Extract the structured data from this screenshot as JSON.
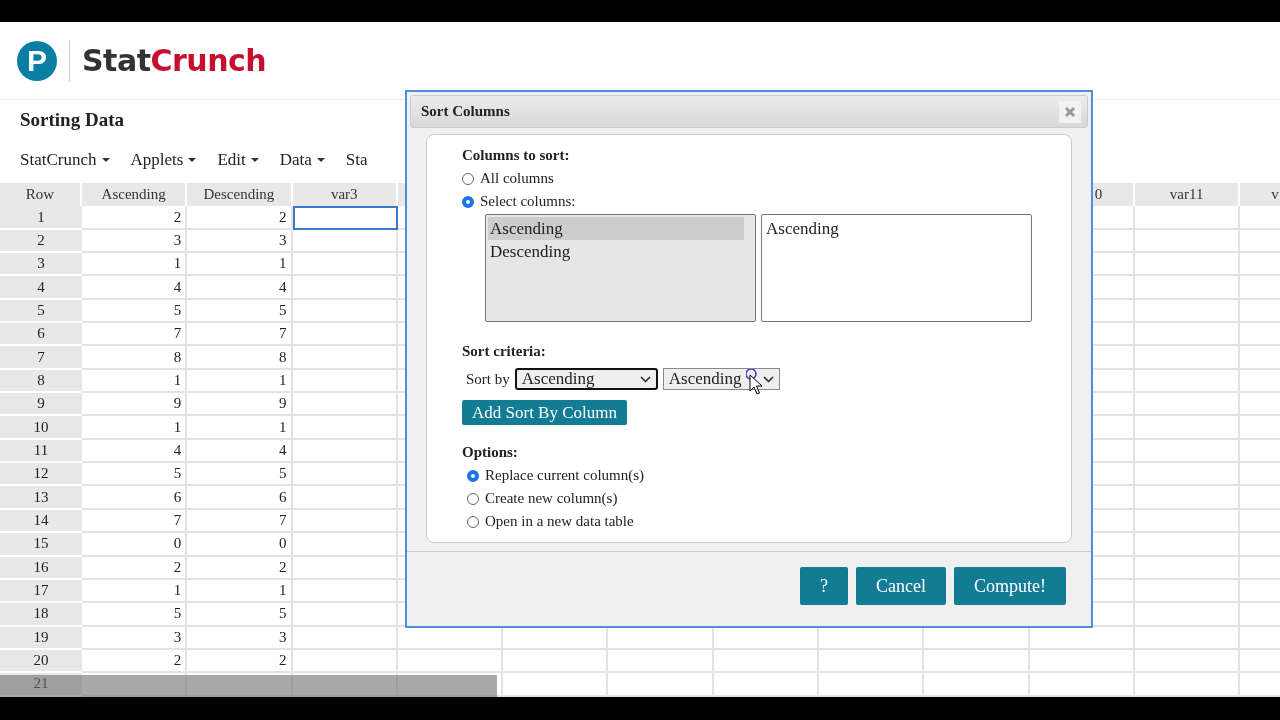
{
  "logo": {
    "mark": "P",
    "brand": [
      {
        "text": "Stat",
        "accent": false
      },
      {
        "text": "Crunch",
        "accent": true
      }
    ]
  },
  "page_title": "Sorting Data",
  "menu": [
    {
      "label": "StatCrunch",
      "caret": true
    },
    {
      "label": "Applets",
      "caret": true
    },
    {
      "label": "Edit",
      "caret": true
    },
    {
      "label": "Data",
      "caret": true
    },
    {
      "label": "Sta",
      "caret": false
    }
  ],
  "grid": {
    "columns": [
      "Row",
      "Ascending",
      "Descending",
      "var3",
      "0",
      "var11",
      "v"
    ],
    "rows": [
      {
        "row": "1",
        "values": [
          "2",
          "2"
        ],
        "current": true
      },
      {
        "row": "2",
        "values": [
          "3",
          "3"
        ],
        "current": false
      },
      {
        "row": "3",
        "values": [
          "1",
          "1"
        ],
        "current": false
      },
      {
        "row": "4",
        "values": [
          "4",
          "4"
        ],
        "current": false
      },
      {
        "row": "5",
        "values": [
          "5",
          "5"
        ],
        "current": false
      },
      {
        "row": "6",
        "values": [
          "7",
          "7"
        ],
        "current": false
      },
      {
        "row": "7",
        "values": [
          "8",
          "8"
        ],
        "current": false
      },
      {
        "row": "8",
        "values": [
          "1",
          "1"
        ],
        "current": false
      },
      {
        "row": "9",
        "values": [
          "9",
          "9"
        ],
        "current": false
      },
      {
        "row": "10",
        "values": [
          "1",
          "1"
        ],
        "current": false
      },
      {
        "row": "11",
        "values": [
          "4",
          "4"
        ],
        "current": false
      },
      {
        "row": "12",
        "values": [
          "5",
          "5"
        ],
        "current": false
      },
      {
        "row": "13",
        "values": [
          "6",
          "6"
        ],
        "current": false
      },
      {
        "row": "14",
        "values": [
          "7",
          "7"
        ],
        "current": false
      },
      {
        "row": "15",
        "values": [
          "0",
          "0"
        ],
        "current": false
      },
      {
        "row": "16",
        "values": [
          "2",
          "2"
        ],
        "current": false
      },
      {
        "row": "17",
        "values": [
          "1",
          "1"
        ],
        "current": false
      },
      {
        "row": "18",
        "values": [
          "5",
          "5"
        ],
        "current": false
      },
      {
        "row": "19",
        "values": [
          "3",
          "3"
        ],
        "current": false
      },
      {
        "row": "20",
        "values": [
          "2",
          "2"
        ],
        "current": false
      },
      {
        "row": "21",
        "values": [],
        "current": false
      }
    ]
  },
  "dialog": {
    "title": "Sort Columns",
    "columns_heading": "Columns to sort:",
    "column_modes": [
      {
        "label": "All columns",
        "selected": false
      },
      {
        "label": "Select columns:",
        "selected": true
      }
    ],
    "available": [
      {
        "label": "Ascending",
        "selected": true
      },
      {
        "label": "Descending",
        "selected": false
      }
    ],
    "chosen": [
      {
        "label": "Ascending"
      }
    ],
    "criteria_heading": "Sort criteria:",
    "sort_by_label": "Sort by",
    "sort_column": "Ascending",
    "sort_order": "Ascending",
    "add_button": "Add Sort By Column",
    "options_heading": "Options:",
    "options": [
      {
        "label": "Replace current column(s)",
        "selected": true
      },
      {
        "label": "Create new column(s)",
        "selected": false
      },
      {
        "label": "Open in a new data table",
        "selected": false
      }
    ],
    "buttons": [
      "?",
      "Cancel",
      "Compute!"
    ]
  }
}
